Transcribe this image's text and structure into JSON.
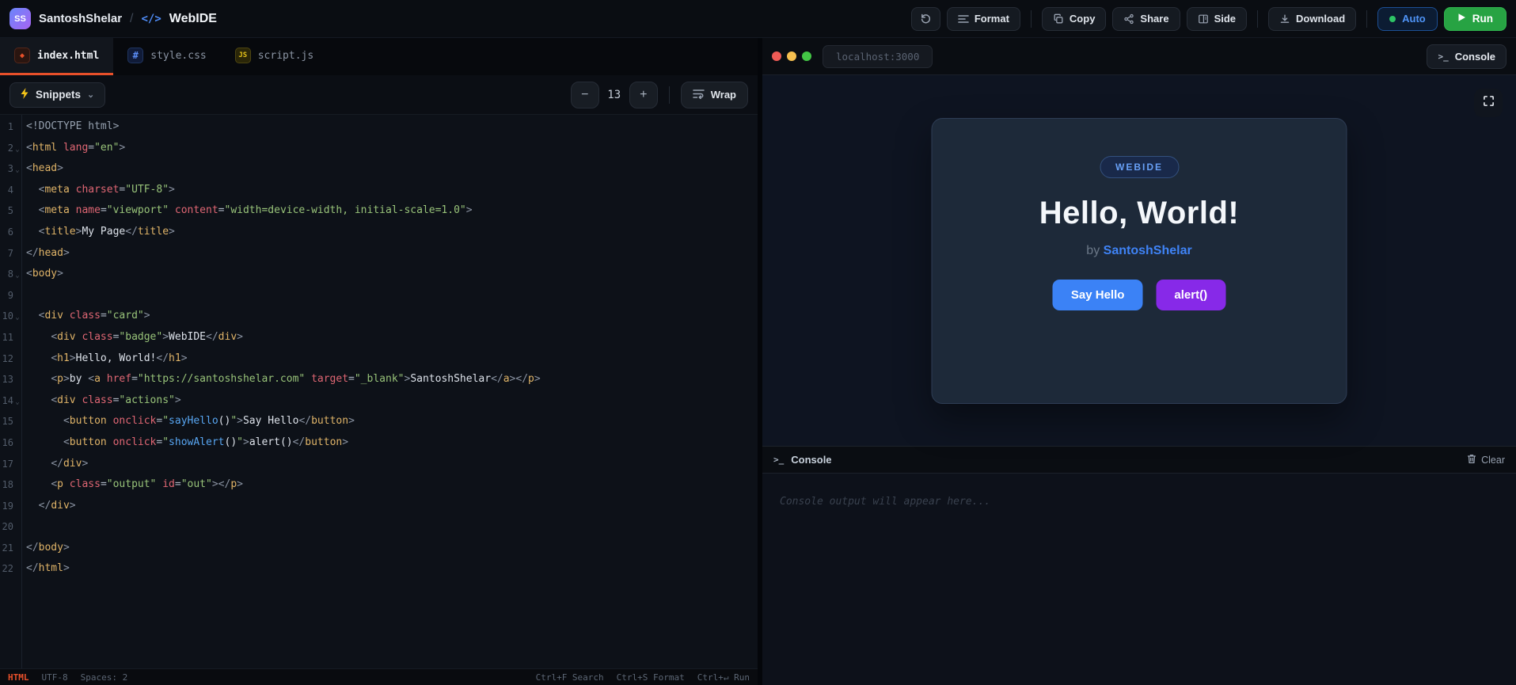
{
  "topbar": {
    "logo": "SS",
    "project": "SantoshShelar",
    "separator": "/",
    "code_glyph": "</>",
    "app": "WebIDE",
    "format_label": "Format",
    "copy_label": "Copy",
    "share_label": "Share",
    "side_label": "Side",
    "download_label": "Download",
    "auto_label": "Auto",
    "run_label": "Run"
  },
  "tabs": [
    {
      "label": "index.html",
      "icon": "◆",
      "active": true
    },
    {
      "label": "style.css",
      "icon": "#",
      "active": false
    },
    {
      "label": "script.js",
      "icon": "JS",
      "active": false
    }
  ],
  "toolbar": {
    "snippets_label": "Snippets",
    "chevron_glyph": "⌄",
    "minus_glyph": "−",
    "font_size": "13",
    "plus_glyph": "+",
    "wrap_label": "Wrap"
  },
  "editor": {
    "fold_glyph": "⌄",
    "lines": [
      {
        "fold": false,
        "tokens": [
          [
            "doc",
            "<!DOCTYPE html>"
          ]
        ]
      },
      {
        "fold": true,
        "tokens": [
          [
            "pun",
            "<"
          ],
          [
            "tag",
            "html"
          ],
          [
            "plain",
            " "
          ],
          [
            "attr",
            "lang"
          ],
          [
            "eq",
            "="
          ],
          [
            "str",
            "\"en\""
          ],
          [
            "pun",
            ">"
          ]
        ]
      },
      {
        "fold": true,
        "tokens": [
          [
            "pun",
            "<"
          ],
          [
            "tag",
            "head"
          ],
          [
            "pun",
            ">"
          ]
        ]
      },
      {
        "fold": false,
        "tokens": [
          [
            "plain",
            "  "
          ],
          [
            "pun",
            "<"
          ],
          [
            "tag",
            "meta"
          ],
          [
            "plain",
            " "
          ],
          [
            "attr",
            "charset"
          ],
          [
            "eq",
            "="
          ],
          [
            "str",
            "\"UTF-8\""
          ],
          [
            "pun",
            ">"
          ]
        ]
      },
      {
        "fold": false,
        "tokens": [
          [
            "plain",
            "  "
          ],
          [
            "pun",
            "<"
          ],
          [
            "tag",
            "meta"
          ],
          [
            "plain",
            " "
          ],
          [
            "attr",
            "name"
          ],
          [
            "eq",
            "="
          ],
          [
            "str",
            "\"viewport\""
          ],
          [
            "plain",
            " "
          ],
          [
            "attr",
            "content"
          ],
          [
            "eq",
            "="
          ],
          [
            "str",
            "\"width=device-width, initial-scale=1.0\""
          ],
          [
            "pun",
            ">"
          ]
        ]
      },
      {
        "fold": false,
        "tokens": [
          [
            "plain",
            "  "
          ],
          [
            "pun",
            "<"
          ],
          [
            "tag",
            "title"
          ],
          [
            "pun",
            ">"
          ],
          [
            "txt",
            "My Page"
          ],
          [
            "pun",
            "</"
          ],
          [
            "tag",
            "title"
          ],
          [
            "pun",
            ">"
          ]
        ]
      },
      {
        "fold": false,
        "tokens": [
          [
            "pun",
            "</"
          ],
          [
            "tag",
            "head"
          ],
          [
            "pun",
            ">"
          ]
        ]
      },
      {
        "fold": true,
        "tokens": [
          [
            "pun",
            "<"
          ],
          [
            "tag",
            "body"
          ],
          [
            "pun",
            ">"
          ]
        ]
      },
      {
        "fold": false,
        "tokens": []
      },
      {
        "fold": true,
        "tokens": [
          [
            "plain",
            "  "
          ],
          [
            "pun",
            "<"
          ],
          [
            "tag",
            "div"
          ],
          [
            "plain",
            " "
          ],
          [
            "attr",
            "class"
          ],
          [
            "eq",
            "="
          ],
          [
            "str",
            "\"card\""
          ],
          [
            "pun",
            ">"
          ]
        ]
      },
      {
        "fold": false,
        "tokens": [
          [
            "plain",
            "    "
          ],
          [
            "pun",
            "<"
          ],
          [
            "tag",
            "div"
          ],
          [
            "plain",
            " "
          ],
          [
            "attr",
            "class"
          ],
          [
            "eq",
            "="
          ],
          [
            "str",
            "\"badge\""
          ],
          [
            "pun",
            ">"
          ],
          [
            "txt",
            "WebIDE"
          ],
          [
            "pun",
            "</"
          ],
          [
            "tag",
            "div"
          ],
          [
            "pun",
            ">"
          ]
        ]
      },
      {
        "fold": false,
        "tokens": [
          [
            "plain",
            "    "
          ],
          [
            "pun",
            "<"
          ],
          [
            "tag",
            "h1"
          ],
          [
            "pun",
            ">"
          ],
          [
            "txt",
            "Hello, World!"
          ],
          [
            "pun",
            "</"
          ],
          [
            "tag",
            "h1"
          ],
          [
            "pun",
            ">"
          ]
        ]
      },
      {
        "fold": false,
        "tokens": [
          [
            "plain",
            "    "
          ],
          [
            "pun",
            "<"
          ],
          [
            "tag",
            "p"
          ],
          [
            "pun",
            ">"
          ],
          [
            "txt",
            "by "
          ],
          [
            "pun",
            "<"
          ],
          [
            "tag",
            "a"
          ],
          [
            "plain",
            " "
          ],
          [
            "attr",
            "href"
          ],
          [
            "eq",
            "="
          ],
          [
            "str",
            "\"https://santoshshelar.com\""
          ],
          [
            "plain",
            " "
          ],
          [
            "attr",
            "target"
          ],
          [
            "eq",
            "="
          ],
          [
            "str",
            "\"_blank\""
          ],
          [
            "pun",
            ">"
          ],
          [
            "txt",
            "SantoshShelar"
          ],
          [
            "pun",
            "</"
          ],
          [
            "tag",
            "a"
          ],
          [
            "pun",
            "></"
          ],
          [
            "tag",
            "p"
          ],
          [
            "pun",
            ">"
          ]
        ]
      },
      {
        "fold": true,
        "tokens": [
          [
            "plain",
            "    "
          ],
          [
            "pun",
            "<"
          ],
          [
            "tag",
            "div"
          ],
          [
            "plain",
            " "
          ],
          [
            "attr",
            "class"
          ],
          [
            "eq",
            "="
          ],
          [
            "str",
            "\"actions\""
          ],
          [
            "pun",
            ">"
          ]
        ]
      },
      {
        "fold": false,
        "tokens": [
          [
            "plain",
            "      "
          ],
          [
            "pun",
            "<"
          ],
          [
            "tag",
            "button"
          ],
          [
            "plain",
            " "
          ],
          [
            "attr",
            "onclick"
          ],
          [
            "eq",
            "="
          ],
          [
            "str",
            "\""
          ],
          [
            "fn",
            "sayHello"
          ],
          [
            "txt",
            "()"
          ],
          [
            "str",
            "\""
          ],
          [
            "pun",
            ">"
          ],
          [
            "txt",
            "Say Hello"
          ],
          [
            "pun",
            "</"
          ],
          [
            "tag",
            "button"
          ],
          [
            "pun",
            ">"
          ]
        ]
      },
      {
        "fold": false,
        "tokens": [
          [
            "plain",
            "      "
          ],
          [
            "pun",
            "<"
          ],
          [
            "tag",
            "button"
          ],
          [
            "plain",
            " "
          ],
          [
            "attr",
            "onclick"
          ],
          [
            "eq",
            "="
          ],
          [
            "str",
            "\""
          ],
          [
            "fn",
            "showAlert"
          ],
          [
            "txt",
            "()"
          ],
          [
            "str",
            "\""
          ],
          [
            "pun",
            ">"
          ],
          [
            "txt",
            "alert()"
          ],
          [
            "pun",
            "</"
          ],
          [
            "tag",
            "button"
          ],
          [
            "pun",
            ">"
          ]
        ]
      },
      {
        "fold": false,
        "tokens": [
          [
            "plain",
            "    "
          ],
          [
            "pun",
            "</"
          ],
          [
            "tag",
            "div"
          ],
          [
            "pun",
            ">"
          ]
        ]
      },
      {
        "fold": false,
        "tokens": [
          [
            "plain",
            "    "
          ],
          [
            "pun",
            "<"
          ],
          [
            "tag",
            "p"
          ],
          [
            "plain",
            " "
          ],
          [
            "attr",
            "class"
          ],
          [
            "eq",
            "="
          ],
          [
            "str",
            "\"output\""
          ],
          [
            "plain",
            " "
          ],
          [
            "attr",
            "id"
          ],
          [
            "eq",
            "="
          ],
          [
            "str",
            "\"out\""
          ],
          [
            "pun",
            "></"
          ],
          [
            "tag",
            "p"
          ],
          [
            "pun",
            ">"
          ]
        ]
      },
      {
        "fold": false,
        "tokens": [
          [
            "plain",
            "  "
          ],
          [
            "pun",
            "</"
          ],
          [
            "tag",
            "div"
          ],
          [
            "pun",
            ">"
          ]
        ]
      },
      {
        "fold": false,
        "tokens": []
      },
      {
        "fold": false,
        "tokens": [
          [
            "pun",
            "</"
          ],
          [
            "tag",
            "body"
          ],
          [
            "pun",
            ">"
          ]
        ]
      },
      {
        "fold": false,
        "tokens": [
          [
            "pun",
            "</"
          ],
          [
            "tag",
            "html"
          ],
          [
            "pun",
            ">"
          ]
        ]
      }
    ]
  },
  "statusbar": {
    "left": [
      "HTML",
      "UTF-8",
      "Spaces: 2"
    ],
    "right": [
      "Ctrl+F Search",
      "Ctrl+S Format",
      "Ctrl+↵ Run"
    ]
  },
  "preview": {
    "url": "localhost:3000",
    "console_button_label": "Console",
    "terminal_glyph": ">_",
    "badge": "WEBIDE",
    "title": "Hello, World!",
    "byline_prefix": "by",
    "byline_author": "SantoshShelar",
    "btn_primary": "Say Hello",
    "btn_secondary": "alert()"
  },
  "console": {
    "title": "Console",
    "terminal_glyph": ">_",
    "clear_label": "Clear",
    "placeholder": "Console output will appear here..."
  },
  "colors": {
    "accent_orange": "#e8502a",
    "accent_blue": "#3b82f6",
    "accent_purple": "#8729e8",
    "run_green": "#27a343",
    "auto_blue": "#4f94f7"
  }
}
